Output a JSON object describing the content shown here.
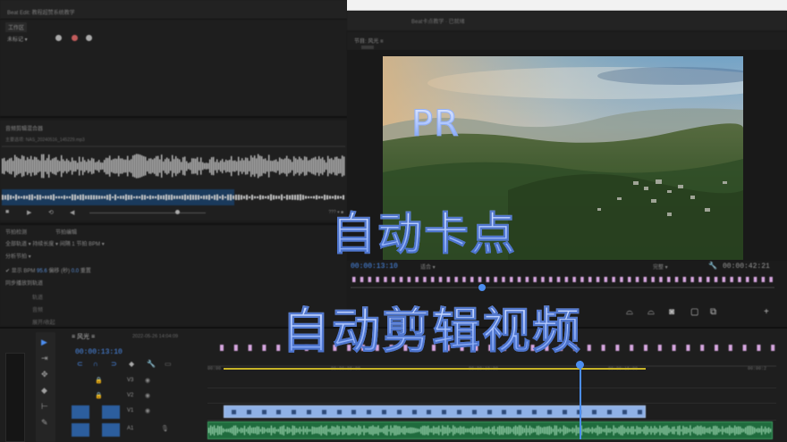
{
  "overlay": {
    "badge": "PR",
    "line1": "自动卡点",
    "line2": "自动剪辑视频"
  },
  "topbar": {
    "title": "Beat Edit: 教程超赞系统教学"
  },
  "essential_sound": {
    "tab": "工作区",
    "preset": "未标记 ▾"
  },
  "audio_panel": {
    "header": "音频剪辑混合器",
    "clip_name": "主要选项: NAS_20240516_145229.mp3",
    "zoom": "??? ▾ ■"
  },
  "effects": {
    "tab_a": "节拍检测",
    "tab_b": "节拍编辑",
    "row1": "全部轨道 ▾   持续长度 ▾   间隔 1   节拍   BPM ▾",
    "row2": "分析节拍 ▾",
    "row3_a": "✔ 显示  BPM",
    "row3_b": "95.6",
    "row3_c": "偏移 (秒)",
    "row3_d": "0.0",
    "row3_e": "重置",
    "row4": "同步播放到轨道",
    "row5": "轨道",
    "row6": "音频",
    "row7": "展开/收起"
  },
  "monitor": {
    "header_title": "Beat卡点教学 · 已就绪",
    "program_label": "节目: 风光 ≡",
    "timecode_left": "00:00:13:10",
    "fit": "适合 ▾",
    "quality": "完整 ▾",
    "timecode_right": "00:00:42:21"
  },
  "timeline": {
    "sequence_tab": "≡ 风光 ≡",
    "sequence_date": "2022-05-26 14:04:09",
    "timecode": "00:00:13:10",
    "ruler": [
      "00:00",
      "00:00:05:00",
      "00:00:10:00",
      "00:00:15:00",
      "00:00:2"
    ],
    "tracks": [
      {
        "name": "V3"
      },
      {
        "name": "V2"
      },
      {
        "name": "V1"
      },
      {
        "name": "A1"
      }
    ]
  },
  "colors": {
    "accent": "#4c8ef0",
    "work_area": "#c7b327",
    "video_clip": "#8fb1e6",
    "audio_clip": "#1f6b3d",
    "marker": "#d7a6e0"
  }
}
